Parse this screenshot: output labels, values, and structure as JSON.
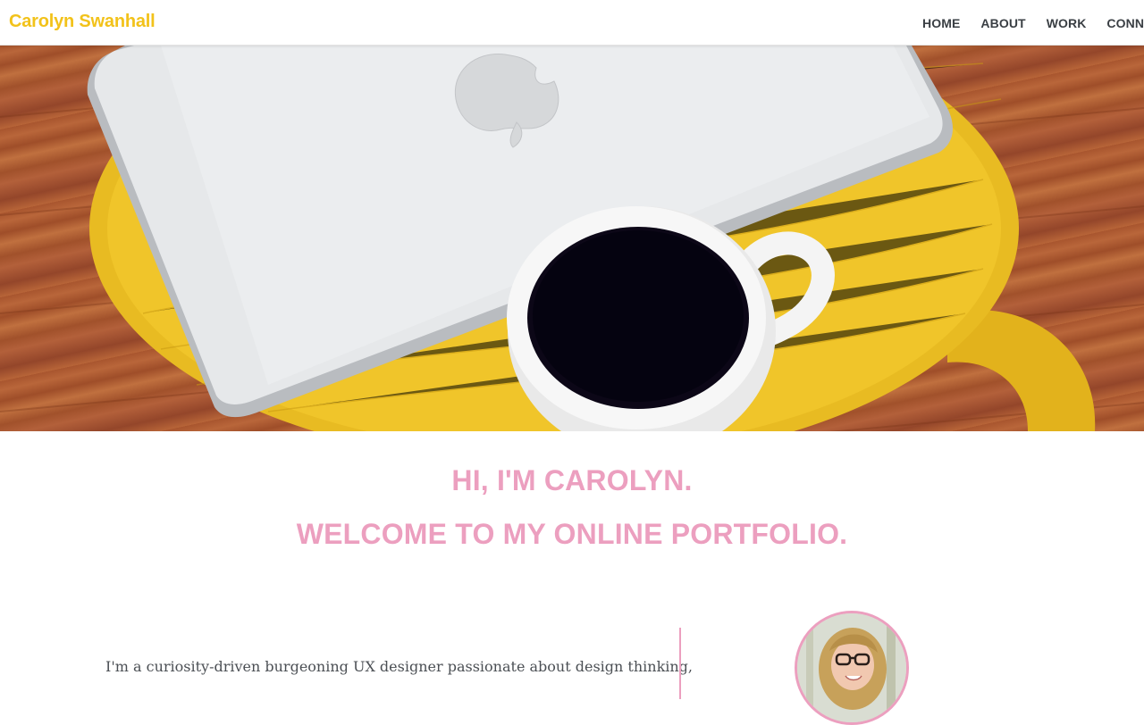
{
  "brand": {
    "name": "Carolyn Swanhall",
    "color": "#f2c21a"
  },
  "nav": {
    "items": [
      {
        "label": "HOME"
      },
      {
        "label": "ABOUT"
      },
      {
        "label": "WORK"
      },
      {
        "label": "CONNECT"
      }
    ]
  },
  "hero": {
    "image": "laptop-and-coffee-on-yellow-stool"
  },
  "headline": {
    "line1": "HI, I'M CAROLYN.",
    "line2": "WELCOME TO MY ONLINE PORTFOLIO.",
    "color": "#ec9fbf"
  },
  "intro": {
    "text": "I'm a curiosity-driven burgeoning UX designer passionate about design thinking,"
  },
  "avatar": {
    "image": "profile-photo"
  }
}
